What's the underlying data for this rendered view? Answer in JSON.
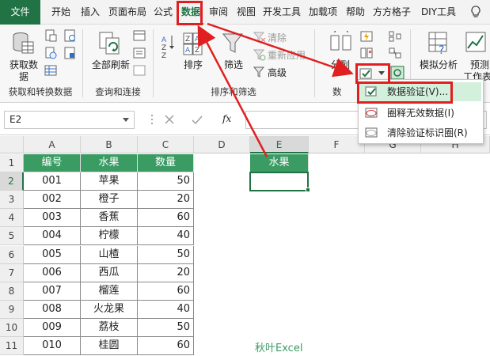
{
  "tabs": [
    "文件",
    "开始",
    "插入",
    "页面布局",
    "公式",
    "数据",
    "审阅",
    "视图",
    "开发工具",
    "加载项",
    "帮助",
    "方方格子",
    "DIY工具箱"
  ],
  "active_tab": "数据",
  "ribbon": {
    "get_data_line1": "获取数",
    "get_data_line2": "据",
    "group_get": "获取和转换数据",
    "refresh_all": "全部刷新",
    "group_query": "查询和连接",
    "sort": "排序",
    "filter": "筛选",
    "clear": "清除",
    "reapply": "重新应用",
    "advanced": "高级",
    "group_sort": "排序和筛选",
    "split": "分列",
    "group_data": "数",
    "whatif": "模拟分析",
    "forecast_line1": "预测",
    "forecast_line2": "工作表"
  },
  "menu": {
    "item1": "数据验证(V)...",
    "item2": "圈释无效数据(I)",
    "item3": "清除验证标识圈(R)"
  },
  "namebox": "E2",
  "fx": "fx",
  "columns": [
    "A",
    "B",
    "C",
    "D",
    "E",
    "F",
    "G",
    "H"
  ],
  "rows": [
    "1",
    "2",
    "3",
    "4",
    "5",
    "6",
    "7",
    "8",
    "9",
    "10",
    "11"
  ],
  "table_header": [
    "编号",
    "水果",
    "数量"
  ],
  "table_rows": [
    [
      "001",
      "苹果",
      "50"
    ],
    [
      "002",
      "橙子",
      "20"
    ],
    [
      "003",
      "香蕉",
      "60"
    ],
    [
      "004",
      "柠檬",
      "40"
    ],
    [
      "005",
      "山楂",
      "50"
    ],
    [
      "006",
      "西瓜",
      "20"
    ],
    [
      "007",
      "榴莲",
      "60"
    ],
    [
      "008",
      "火龙果",
      "40"
    ],
    [
      "009",
      "荔枝",
      "50"
    ],
    [
      "010",
      "桂圆",
      "60"
    ]
  ],
  "e1_header": "水果",
  "watermark": "秋叶Excel",
  "colors": {
    "excel_green": "#217346",
    "header_green": "#3a9b63",
    "highlight_red": "#e02020"
  }
}
